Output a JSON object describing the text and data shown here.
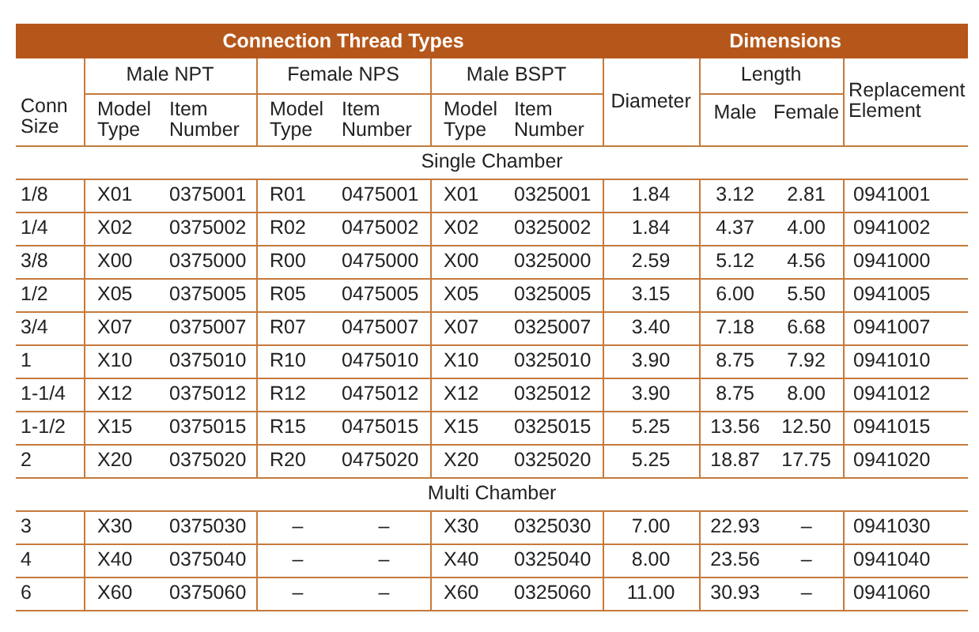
{
  "header": {
    "group_1": "Connection Thread Types",
    "group_2": "Dimensions"
  },
  "subheader": {
    "conn_size": "Conn Size",
    "male_npt": "Male NPT",
    "female_nps": "Female NPS",
    "male_bspt": "Male BSPT",
    "diameter": "Diameter",
    "length": "Length",
    "replacement": "Replacement Element",
    "model_type": [
      "Model Type",
      "Model Type",
      "Model Type"
    ],
    "item_number": [
      "Item Number",
      "Item Number",
      "Item Number"
    ],
    "length_male": "Male",
    "length_female": "Female"
  },
  "sections": [
    {
      "title": "Single Chamber",
      "rows": [
        [
          "1/8",
          "X01",
          "0375001",
          "R01",
          "0475001",
          "X01",
          "0325001",
          "1.84",
          "3.12",
          "2.81",
          "0941001"
        ],
        [
          "1/4",
          "X02",
          "0375002",
          "R02",
          "0475002",
          "X02",
          "0325002",
          "1.84",
          "4.37",
          "4.00",
          "0941002"
        ],
        [
          "3/8",
          "X00",
          "0375000",
          "R00",
          "0475000",
          "X00",
          "0325000",
          "2.59",
          "5.12",
          "4.56",
          "0941000"
        ],
        [
          "1/2",
          "X05",
          "0375005",
          "R05",
          "0475005",
          "X05",
          "0325005",
          "3.15",
          "6.00",
          "5.50",
          "0941005"
        ],
        [
          "3/4",
          "X07",
          "0375007",
          "R07",
          "0475007",
          "X07",
          "0325007",
          "3.40",
          "7.18",
          "6.68",
          "0941007"
        ],
        [
          "1",
          "X10",
          "0375010",
          "R10",
          "0475010",
          "X10",
          "0325010",
          "3.90",
          "8.75",
          "7.92",
          "0941010"
        ],
        [
          "1-1/4",
          "X12",
          "0375012",
          "R12",
          "0475012",
          "X12",
          "0325012",
          "3.90",
          "8.75",
          "8.00",
          "0941012"
        ],
        [
          "1-1/2",
          "X15",
          "0375015",
          "R15",
          "0475015",
          "X15",
          "0325015",
          "5.25",
          "13.56",
          "12.50",
          "0941015"
        ],
        [
          "2",
          "X20",
          "0375020",
          "R20",
          "0475020",
          "X20",
          "0325020",
          "5.25",
          "18.87",
          "17.75",
          "0941020"
        ]
      ]
    },
    {
      "title": "Multi Chamber",
      "rows": [
        [
          "3",
          "X30",
          "0375030",
          "–",
          "–",
          "X30",
          "0325030",
          "7.00",
          "22.93",
          "–",
          "0941030"
        ],
        [
          "4",
          "X40",
          "0375040",
          "–",
          "–",
          "X40",
          "0325040",
          "8.00",
          "23.56",
          "–",
          "0941040"
        ],
        [
          "6",
          "X60",
          "0375060",
          "–",
          "–",
          "X60",
          "0325060",
          "11.00",
          "30.93",
          "–",
          "0941060"
        ]
      ]
    }
  ]
}
